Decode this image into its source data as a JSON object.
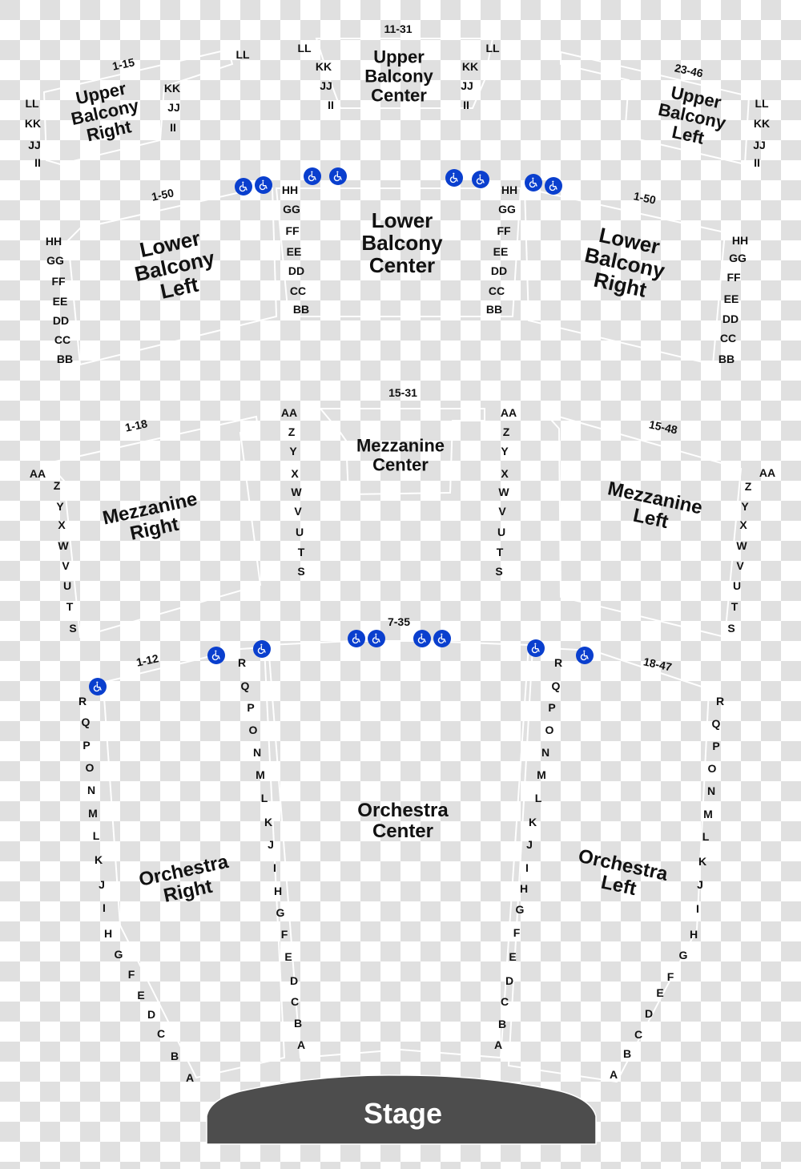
{
  "colors": {
    "accessible_icon": "#0a3fce",
    "stage_fill": "#4d4d4d",
    "section_outline": "#ffffff",
    "checker_gray": "#e0e0e0"
  },
  "stage": {
    "label": "Stage"
  },
  "sections": {
    "upper_balcony_right": {
      "name": "Upper\nBalcony\nRight",
      "seats": "1-15",
      "rows_outer": [
        "LL",
        "KK",
        "JJ",
        "II"
      ],
      "rows_inner": [
        "LL",
        "KK",
        "JJ",
        "II"
      ]
    },
    "upper_balcony_center": {
      "name": "Upper\nBalcony\nCenter",
      "seats": "11-31",
      "rows_left": [
        "LL",
        "KK",
        "JJ",
        "II"
      ],
      "rows_right": [
        "LL",
        "KK",
        "JJ",
        "II"
      ]
    },
    "upper_balcony_left": {
      "name": "Upper\nBalcony\nLeft",
      "seats": "23-46",
      "rows_outer": [
        "LL",
        "KK",
        "JJ",
        "II"
      ]
    },
    "lower_balcony_left": {
      "name": "Lower\nBalcony\nLeft",
      "seats": "1-50",
      "rows_outer": [
        "HH",
        "GG",
        "FF",
        "EE",
        "DD",
        "CC",
        "BB"
      ]
    },
    "lower_balcony_center": {
      "name": "Lower\nBalcony\nCenter",
      "rows_left": [
        "HH",
        "GG",
        "FF",
        "EE",
        "DD",
        "CC",
        "BB"
      ],
      "rows_right": [
        "HH",
        "GG",
        "FF",
        "EE",
        "DD",
        "CC",
        "BB"
      ]
    },
    "lower_balcony_right": {
      "name": "Lower\nBalcony\nRight",
      "seats": "1-50",
      "rows_outer": [
        "HH",
        "GG",
        "FF",
        "EE",
        "DD",
        "CC",
        "BB"
      ]
    },
    "mezzanine_right": {
      "name": "Mezzanine\nRight",
      "seats": "1-18",
      "rows_outer": [
        "AA",
        "Z",
        "Y",
        "X",
        "W",
        "V",
        "U",
        "T",
        "S"
      ]
    },
    "mezzanine_center": {
      "name": "Mezzanine\nCenter",
      "seats": "15-31",
      "rows_left": [
        "AA",
        "Z",
        "Y",
        "X",
        "W",
        "V",
        "U",
        "T",
        "S"
      ],
      "rows_right": [
        "AA",
        "Z",
        "Y",
        "X",
        "W",
        "V",
        "U",
        "T",
        "S"
      ]
    },
    "mezzanine_left": {
      "name": "Mezzanine\nLeft",
      "seats": "15-48",
      "rows_outer": [
        "AA",
        "Z",
        "Y",
        "X",
        "W",
        "V",
        "U",
        "T",
        "S"
      ]
    },
    "orchestra_right": {
      "name": "Orchestra\nRight",
      "seats": "1-12",
      "rows_outer": [
        "R",
        "Q",
        "P",
        "O",
        "N",
        "M",
        "L",
        "K",
        "J",
        "I",
        "H",
        "G",
        "F",
        "E",
        "D",
        "C",
        "B",
        "A"
      ]
    },
    "orchestra_center": {
      "name": "Orchestra\nCenter",
      "seats": "7-35",
      "rows_left": [
        "R",
        "Q",
        "P",
        "O",
        "N",
        "M",
        "L",
        "K",
        "J",
        "I",
        "H",
        "G",
        "F",
        "E",
        "D",
        "C",
        "B",
        "A"
      ],
      "rows_right": [
        "R",
        "Q",
        "P",
        "O",
        "N",
        "M",
        "L",
        "K",
        "J",
        "I",
        "H",
        "G",
        "F",
        "E",
        "D",
        "C",
        "B",
        "A"
      ]
    },
    "orchestra_left": {
      "name": "Orchestra\nLeft",
      "seats": "18-47",
      "rows_outer": [
        "R",
        "Q",
        "P",
        "O",
        "N",
        "M",
        "L",
        "K",
        "J",
        "I",
        "H",
        "G",
        "F",
        "E",
        "D",
        "C",
        "B",
        "A"
      ]
    }
  },
  "icons": {
    "accessible_seating": "wheelchair-icon"
  }
}
